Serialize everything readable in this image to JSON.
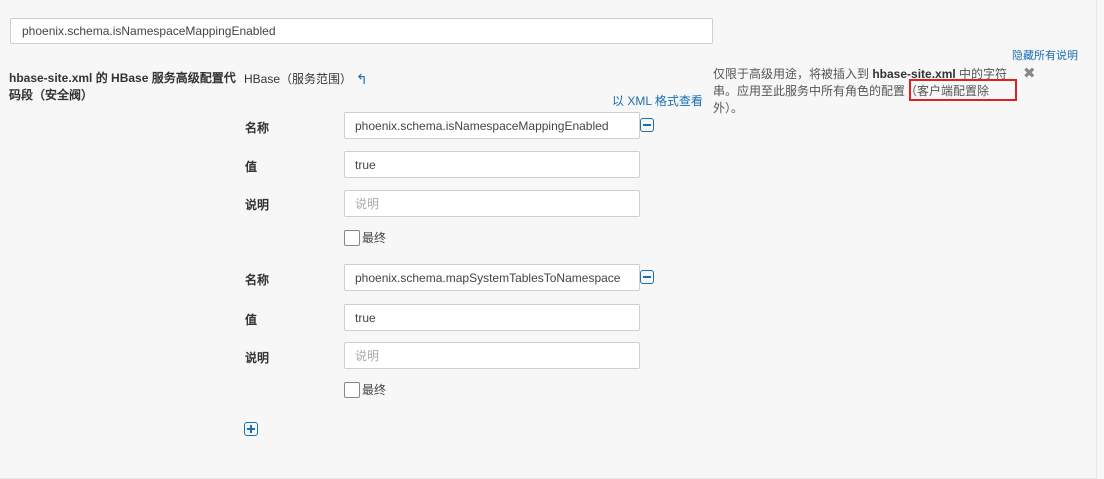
{
  "search": {
    "value": "phoenix.schema.isNamespaceMappingEnabled"
  },
  "hide_all_label": "隐藏所有说明",
  "property": {
    "title": "hbase-site.xml 的 HBase 服务高级配置代码段（安全阀）",
    "scope": "HBase（服务范围）",
    "xml_link": "以 XML 格式查看"
  },
  "description": {
    "part1": "仅限于高级用途，将被插入到 ",
    "file": "hbase-site.xml",
    "part2": " 中的字符串。应用至此服务中所有角色的配置（客户端配置除外）。"
  },
  "labels": {
    "name": "名称",
    "value": "值",
    "description": "说明",
    "final": "最终",
    "description_placeholder": "说明"
  },
  "entries": [
    {
      "name": "phoenix.schema.isNamespaceMappingEnabled",
      "value": "true",
      "description": ""
    },
    {
      "name": "phoenix.schema.mapSystemTablesToNamespace",
      "value": "true",
      "description": ""
    }
  ]
}
